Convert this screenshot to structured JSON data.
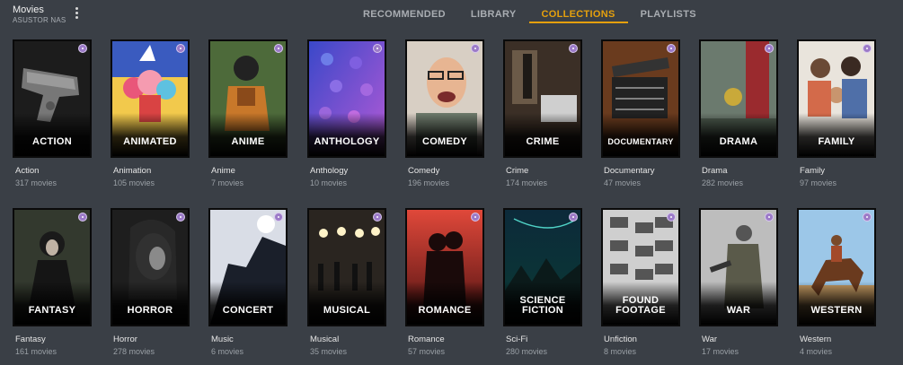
{
  "header": {
    "library_title": "Movies",
    "server_name": "ASUSTOR NAS",
    "tabs": [
      {
        "label": "RECOMMENDED",
        "active": false
      },
      {
        "label": "LIBRARY",
        "active": false
      },
      {
        "label": "COLLECTIONS",
        "active": true
      },
      {
        "label": "PLAYLISTS",
        "active": false
      }
    ],
    "accent_color": "#e5a00d"
  },
  "collections": [
    {
      "poster_label": "ACTION",
      "name": "Action",
      "count": "317 movies"
    },
    {
      "poster_label": "ANIMATED",
      "name": "Animation",
      "count": "105 movies"
    },
    {
      "poster_label": "ANIME",
      "name": "Anime",
      "count": "7 movies"
    },
    {
      "poster_label": "ANTHOLOGY",
      "name": "Anthology",
      "count": "10 movies"
    },
    {
      "poster_label": "COMEDY",
      "name": "Comedy",
      "count": "196 movies"
    },
    {
      "poster_label": "CRIME",
      "name": "Crime",
      "count": "174 movies"
    },
    {
      "poster_label": "DOCUMENTARY",
      "name": "Documentary",
      "count": "47 movies"
    },
    {
      "poster_label": "DRAMA",
      "name": "Drama",
      "count": "282 movies"
    },
    {
      "poster_label": "FAMILY",
      "name": "Family",
      "count": "97 movies"
    },
    {
      "poster_label": "FANTASY",
      "name": "Fantasy",
      "count": "161 movies"
    },
    {
      "poster_label": "HORROR",
      "name": "Horror",
      "count": "278 movies"
    },
    {
      "poster_label": "CONCERT",
      "name": "Music",
      "count": "6 movies"
    },
    {
      "poster_label": "MUSICAL",
      "name": "Musical",
      "count": "35 movies"
    },
    {
      "poster_label": "ROMANCE",
      "name": "Romance",
      "count": "57 movies"
    },
    {
      "poster_label": "SCIENCE FICTION",
      "name": "Sci-Fi",
      "count": "280 movies"
    },
    {
      "poster_label": "FOUND FOOTAGE",
      "name": "Unfiction",
      "count": "8 movies"
    },
    {
      "poster_label": "WAR",
      "name": "War",
      "count": "17 movies"
    },
    {
      "poster_label": "WESTERN",
      "name": "Western",
      "count": "4 movies"
    }
  ]
}
